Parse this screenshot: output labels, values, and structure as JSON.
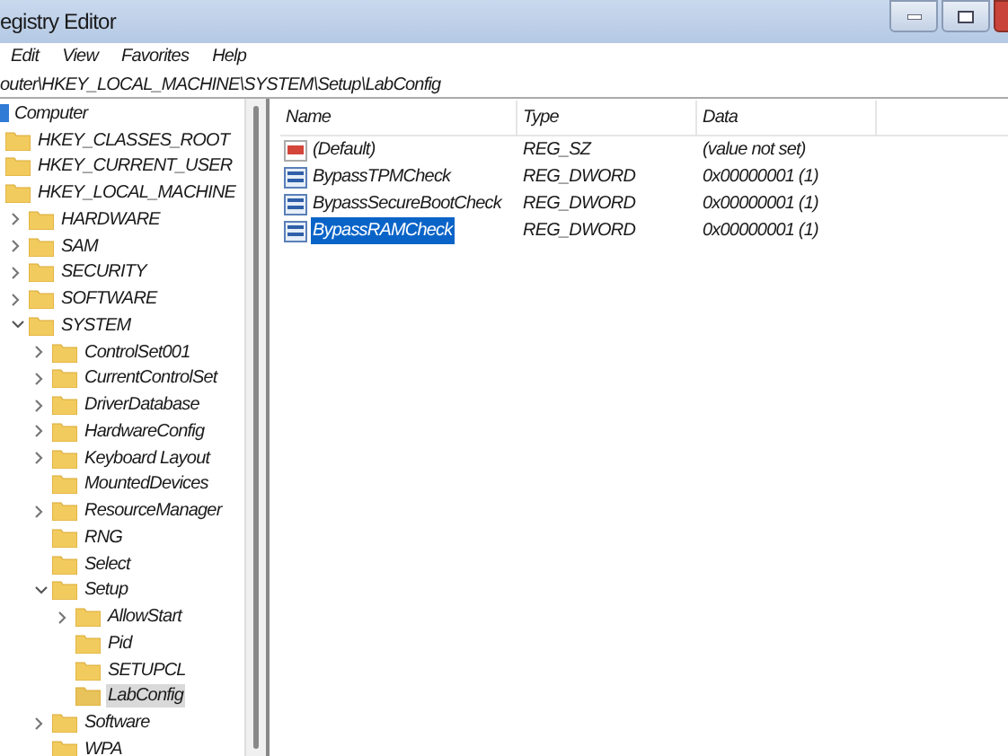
{
  "window": {
    "title": "egistry Editor"
  },
  "menu": [
    "Edit",
    "View",
    "Favorites",
    "Help"
  ],
  "address": "outer\\HKEY_LOCAL_MACHINE\\SYSTEM\\Setup\\LabConfig",
  "tree": {
    "label": "Computer",
    "children": [
      {
        "label": "HKEY_CLASSES_ROOT",
        "kind": "leaf",
        "selected": false
      },
      {
        "label": "HKEY_CURRENT_USER",
        "kind": "leaf",
        "selected": false
      },
      {
        "label": "HKEY_LOCAL_MACHINE",
        "kind": "leaf",
        "selected": false,
        "children": [
          {
            "label": "HARDWARE",
            "kind": "branch",
            "expanded": false,
            "selected": false
          },
          {
            "label": "SAM",
            "kind": "branch",
            "expanded": false,
            "selected": false
          },
          {
            "label": "SECURITY",
            "kind": "branch",
            "expanded": false,
            "selected": false
          },
          {
            "label": "SOFTWARE",
            "kind": "branch",
            "expanded": false,
            "selected": false
          },
          {
            "label": "SYSTEM",
            "kind": "branch",
            "expanded": true,
            "selected": false,
            "children": [
              {
                "label": "ControlSet001",
                "kind": "branch",
                "expanded": false,
                "selected": false
              },
              {
                "label": "CurrentControlSet",
                "kind": "branch",
                "expanded": false,
                "selected": false
              },
              {
                "label": "DriverDatabase",
                "kind": "branch",
                "expanded": false,
                "selected": false
              },
              {
                "label": "HardwareConfig",
                "kind": "branch",
                "expanded": false,
                "selected": false
              },
              {
                "label": "Keyboard Layout",
                "kind": "branch",
                "expanded": false,
                "selected": false
              },
              {
                "label": "MountedDevices",
                "kind": "leaf",
                "selected": false
              },
              {
                "label": "ResourceManager",
                "kind": "branch",
                "expanded": false,
                "selected": false
              },
              {
                "label": "RNG",
                "kind": "leaf",
                "selected": false
              },
              {
                "label": "Select",
                "kind": "leaf",
                "selected": false
              },
              {
                "label": "Setup",
                "kind": "branch",
                "expanded": true,
                "selected": false,
                "children": [
                  {
                    "label": "AllowStart",
                    "kind": "branch",
                    "expanded": false,
                    "selected": false
                  },
                  {
                    "label": "Pid",
                    "kind": "leaf",
                    "selected": false
                  },
                  {
                    "label": "SETUPCL",
                    "kind": "leaf",
                    "selected": false
                  },
                  {
                    "label": "LabConfig",
                    "kind": "leaf",
                    "selected": true
                  }
                ]
              },
              {
                "label": "Software",
                "kind": "branch",
                "expanded": false,
                "selected": false
              },
              {
                "label": "WPA",
                "kind": "leaf",
                "selected": false
              }
            ]
          }
        ]
      }
    ]
  },
  "table": {
    "columns": [
      "Name",
      "Type",
      "Data"
    ],
    "rows": [
      {
        "kind": "string",
        "name": "(Default)",
        "type": "REG_SZ",
        "data": "(value not set)",
        "selected": false
      },
      {
        "kind": "binary",
        "name": "BypassTPMCheck",
        "type": "REG_DWORD",
        "data": "0x00000001 (1)",
        "selected": false
      },
      {
        "kind": "binary",
        "name": "BypassSecureBootCheck",
        "type": "REG_DWORD",
        "data": "0x00000001 (1)",
        "selected": false
      },
      {
        "kind": "binary",
        "name": "BypassRAMCheck",
        "type": "REG_DWORD",
        "data": "0x00000001 (1)",
        "selected": true
      }
    ]
  }
}
